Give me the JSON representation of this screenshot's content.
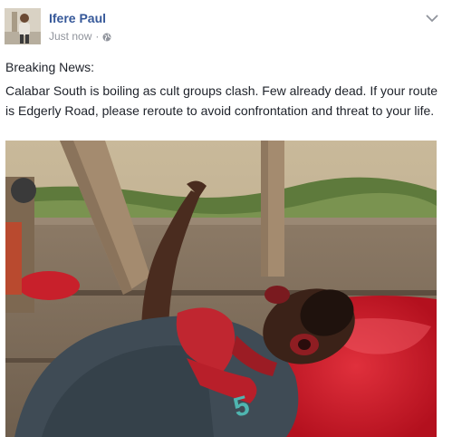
{
  "post": {
    "author": "Ifere Paul",
    "timestamp": "Just now",
    "separator": "·",
    "privacy_icon": "globe-icon",
    "options_icon": "chevron-down-icon",
    "headline": "Breaking News:",
    "body": "Calabar South is boiling as cult groups clash. Few already dead. If your route is Edgerly Road, please reroute to avoid confrontation and threat to your life."
  },
  "colors": {
    "author_link": "#365899",
    "meta_text": "#90949c",
    "body_text": "#1d2129"
  }
}
